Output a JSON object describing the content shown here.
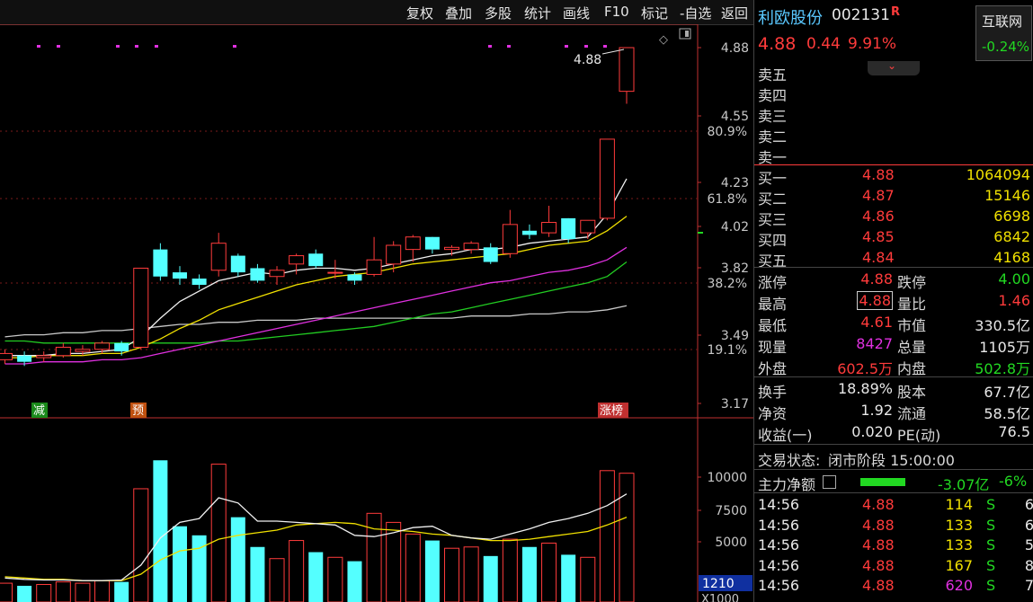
{
  "toolbar": {
    "items": [
      "复权",
      "叠加",
      "多股",
      "统计",
      "画线",
      "F10",
      "标记",
      "-自选",
      "返回"
    ]
  },
  "stock": {
    "name": "利欧股份",
    "code": "002131",
    "flag": "R",
    "price": "4.88",
    "change": "0.44",
    "change_pct": "9.91%",
    "index_name": "互联网",
    "index_pct": "-0.24%"
  },
  "order_book": {
    "sells": [
      {
        "label": "卖五",
        "price": "",
        "vol": ""
      },
      {
        "label": "卖四",
        "price": "",
        "vol": ""
      },
      {
        "label": "卖三",
        "price": "",
        "vol": ""
      },
      {
        "label": "卖二",
        "price": "",
        "vol": ""
      },
      {
        "label": "卖一",
        "price": "",
        "vol": ""
      }
    ],
    "buys": [
      {
        "label": "买一",
        "price": "4.88",
        "vol": "1064094"
      },
      {
        "label": "买二",
        "price": "4.87",
        "vol": "15146"
      },
      {
        "label": "买三",
        "price": "4.86",
        "vol": "6698"
      },
      {
        "label": "买四",
        "price": "4.85",
        "vol": "6842"
      },
      {
        "label": "买五",
        "price": "4.84",
        "vol": "4168"
      }
    ]
  },
  "stats": {
    "limit_up_label": "涨停",
    "limit_up": "4.88",
    "limit_down_label": "跌停",
    "limit_down": "4.00",
    "high_label": "最高",
    "high": "4.88",
    "vol_ratio_label": "量比",
    "vol_ratio": "1.46",
    "low_label": "最低",
    "low": "4.61",
    "mkt_cap_label": "市值",
    "mkt_cap": "330.5亿",
    "cur_vol_label": "现量",
    "cur_vol": "8427",
    "total_vol_label": "总量",
    "total_vol": "1105万",
    "outer_label": "外盘",
    "outer": "602.5万",
    "inner_label": "内盘",
    "inner": "502.8万",
    "turnover_label": "换手",
    "turnover": "18.89%",
    "equity_label": "股本",
    "equity": "67.7亿",
    "nav_label": "净资",
    "nav": "1.92",
    "float_label": "流通",
    "float": "58.5亿",
    "eps_label": "收益(一)",
    "eps": "0.020",
    "pe_label": "PE(动)",
    "pe": "76.5"
  },
  "status": {
    "label": "交易状态:",
    "value": "闭市阶段 15:00:00"
  },
  "main_flow": {
    "label": "主力净额",
    "value": "-3.07亿",
    "pct": "-6%"
  },
  "ticks": [
    {
      "time": "14:56",
      "price": "4.88",
      "vol": "114",
      "side": "S",
      "n": "6"
    },
    {
      "time": "14:56",
      "price": "4.88",
      "vol": "133",
      "side": "S",
      "n": "6"
    },
    {
      "time": "14:56",
      "price": "4.88",
      "vol": "133",
      "side": "S",
      "n": "5"
    },
    {
      "time": "14:56",
      "price": "4.88",
      "vol": "167",
      "side": "S",
      "n": "8"
    },
    {
      "time": "14:56",
      "price": "4.88",
      "vol": "620",
      "side": "S",
      "n": "7"
    }
  ],
  "chart_data": {
    "type": "candlestick",
    "price_axis_ticks": [
      "4.88",
      "4.55",
      "4.23",
      "4.02",
      "3.82",
      "3.49",
      "3.17"
    ],
    "pct_axis_ticks": [
      "80.9%",
      "61.8%",
      "38.2%",
      "19.1%"
    ],
    "volume_axis_ticks": [
      "10000",
      "7500",
      "5000"
    ],
    "volume_cursor_label": "1210",
    "volume_unit": "X1000",
    "max_annotation": "4.88",
    "markers": [
      "减",
      "预",
      "涨榜"
    ],
    "ylim": [
      3.17,
      4.88
    ],
    "candles": [
      {
        "o": 3.38,
        "c": 3.41,
        "h": 3.43,
        "l": 3.36
      },
      {
        "o": 3.4,
        "c": 3.37,
        "h": 3.42,
        "l": 3.35
      },
      {
        "o": 3.39,
        "c": 3.4,
        "h": 3.42,
        "l": 3.37
      },
      {
        "o": 3.4,
        "c": 3.44,
        "h": 3.46,
        "l": 3.39
      },
      {
        "o": 3.42,
        "c": 3.43,
        "h": 3.45,
        "l": 3.4
      },
      {
        "o": 3.43,
        "c": 3.46,
        "h": 3.47,
        "l": 3.41
      },
      {
        "o": 3.46,
        "c": 3.42,
        "h": 3.47,
        "l": 3.4
      },
      {
        "o": 3.44,
        "c": 3.82,
        "h": 3.82,
        "l": 3.43
      },
      {
        "o": 3.91,
        "c": 3.78,
        "h": 3.94,
        "l": 3.76
      },
      {
        "o": 3.8,
        "c": 3.77,
        "h": 3.83,
        "l": 3.74
      },
      {
        "o": 3.77,
        "c": 3.74,
        "h": 3.79,
        "l": 3.72
      },
      {
        "o": 3.81,
        "c": 3.94,
        "h": 3.99,
        "l": 3.78
      },
      {
        "o": 3.88,
        "c": 3.8,
        "h": 3.89,
        "l": 3.78
      },
      {
        "o": 3.82,
        "c": 3.76,
        "h": 3.84,
        "l": 3.75
      },
      {
        "o": 3.78,
        "c": 3.81,
        "h": 3.83,
        "l": 3.74
      },
      {
        "o": 3.84,
        "c": 3.88,
        "h": 3.89,
        "l": 3.79
      },
      {
        "o": 3.89,
        "c": 3.83,
        "h": 3.91,
        "l": 3.82
      },
      {
        "o": 3.8,
        "c": 3.8,
        "h": 3.86,
        "l": 3.77
      },
      {
        "o": 3.79,
        "c": 3.76,
        "h": 3.8,
        "l": 3.74
      },
      {
        "o": 3.79,
        "c": 3.86,
        "h": 3.97,
        "l": 3.78
      },
      {
        "o": 3.84,
        "c": 3.93,
        "h": 3.95,
        "l": 3.8
      },
      {
        "o": 3.91,
        "c": 3.97,
        "h": 3.98,
        "l": 3.85
      },
      {
        "o": 3.97,
        "c": 3.91,
        "h": 3.97,
        "l": 3.89
      },
      {
        "o": 3.91,
        "c": 3.92,
        "h": 3.93,
        "l": 3.88
      },
      {
        "o": 3.91,
        "c": 3.94,
        "h": 3.95,
        "l": 3.89
      },
      {
        "o": 3.92,
        "c": 3.85,
        "h": 3.94,
        "l": 3.84
      },
      {
        "o": 3.89,
        "c": 4.03,
        "h": 4.1,
        "l": 3.87
      },
      {
        "o": 4.0,
        "c": 3.98,
        "h": 4.03,
        "l": 3.96
      },
      {
        "o": 3.99,
        "c": 4.04,
        "h": 4.12,
        "l": 3.97
      },
      {
        "o": 4.06,
        "c": 3.96,
        "h": 4.06,
        "l": 3.94
      },
      {
        "o": 3.99,
        "c": 4.05,
        "h": 4.05,
        "l": 3.96
      },
      {
        "o": 4.06,
        "c": 4.44,
        "h": 4.44,
        "l": 4.05
      },
      {
        "o": 4.67,
        "c": 4.88,
        "h": 4.88,
        "l": 4.61
      }
    ],
    "ma_white": [
      3.4,
      3.4,
      3.4,
      3.41,
      3.41,
      3.42,
      3.43,
      3.49,
      3.58,
      3.66,
      3.71,
      3.76,
      3.78,
      3.8,
      3.79,
      3.81,
      3.82,
      3.82,
      3.81,
      3.82,
      3.84,
      3.86,
      3.88,
      3.89,
      3.91,
      3.91,
      3.92,
      3.94,
      3.95,
      3.96,
      3.97,
      4.08,
      4.25
    ],
    "ma_yellow": [
      3.39,
      3.39,
      3.4,
      3.4,
      3.4,
      3.41,
      3.41,
      3.44,
      3.48,
      3.53,
      3.57,
      3.62,
      3.65,
      3.68,
      3.71,
      3.74,
      3.76,
      3.78,
      3.79,
      3.8,
      3.82,
      3.84,
      3.85,
      3.86,
      3.87,
      3.88,
      3.89,
      3.91,
      3.93,
      3.94,
      3.95,
      4.0,
      4.07
    ],
    "ma_magenta": [
      3.36,
      3.36,
      3.37,
      3.37,
      3.37,
      3.38,
      3.38,
      3.39,
      3.41,
      3.43,
      3.45,
      3.47,
      3.49,
      3.51,
      3.53,
      3.55,
      3.57,
      3.59,
      3.61,
      3.63,
      3.65,
      3.67,
      3.69,
      3.71,
      3.73,
      3.75,
      3.76,
      3.78,
      3.8,
      3.81,
      3.83,
      3.86,
      3.92
    ],
    "ma_green": [
      3.47,
      3.47,
      3.46,
      3.46,
      3.46,
      3.46,
      3.46,
      3.46,
      3.46,
      3.46,
      3.46,
      3.47,
      3.47,
      3.48,
      3.49,
      3.5,
      3.51,
      3.52,
      3.53,
      3.54,
      3.56,
      3.58,
      3.6,
      3.61,
      3.63,
      3.65,
      3.67,
      3.69,
      3.71,
      3.73,
      3.75,
      3.78,
      3.85
    ],
    "ma_gray": [
      3.49,
      3.5,
      3.5,
      3.51,
      3.51,
      3.52,
      3.52,
      3.53,
      3.54,
      3.55,
      3.55,
      3.56,
      3.56,
      3.57,
      3.57,
      3.57,
      3.58,
      3.58,
      3.58,
      3.58,
      3.58,
      3.58,
      3.58,
      3.58,
      3.59,
      3.59,
      3.59,
      3.6,
      3.6,
      3.61,
      3.61,
      3.62,
      3.64
    ],
    "volumes": [
      1800,
      1600,
      1700,
      1900,
      1800,
      2000,
      1900,
      9100,
      11300,
      6200,
      5500,
      11000,
      6900,
      4600,
      3700,
      5100,
      4200,
      3800,
      3500,
      7200,
      6500,
      5600,
      5100,
      4500,
      4600,
      3900,
      5200,
      4600,
      4900,
      4000,
      3800,
      10500,
      10300
    ],
    "vol_ma_white": [
      2200,
      2100,
      2050,
      2050,
      2000,
      2000,
      2050,
      3200,
      5300,
      6500,
      6800,
      8400,
      8000,
      6600,
      6600,
      6500,
      6400,
      6300,
      5500,
      5400,
      5700,
      6100,
      6200,
      5500,
      5300,
      5200,
      5600,
      6000,
      6500,
      6800,
      7200,
      7800,
      8700
    ],
    "vol_ma_yellow": [
      2300,
      2200,
      2100,
      2100,
      2000,
      2000,
      2000,
      2500,
      3600,
      4300,
      4500,
      5200,
      5500,
      5700,
      5900,
      6300,
      6400,
      6500,
      6400,
      6000,
      5900,
      5800,
      5600,
      5500,
      5300,
      5100,
      5100,
      5200,
      5400,
      5600,
      5800,
      6300,
      6900
    ]
  }
}
